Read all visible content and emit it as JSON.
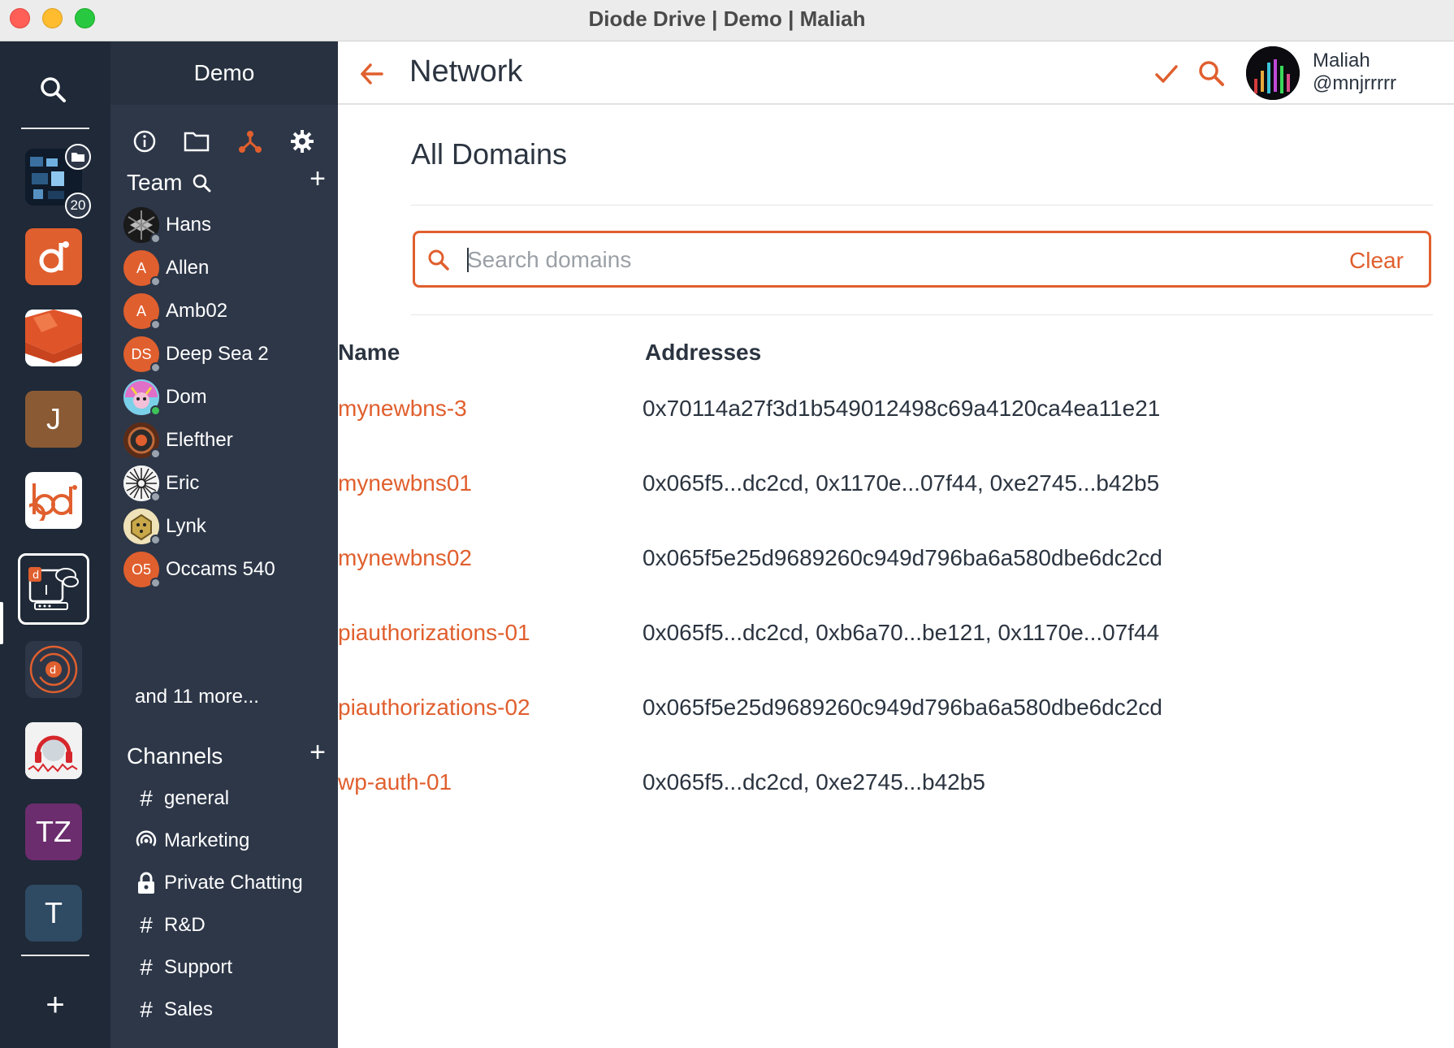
{
  "window": {
    "title": "Diode Drive | Demo | Maliah"
  },
  "rail": {
    "badge_count": "20",
    "tiles": [
      {
        "name": "tile-team-1",
        "letter": "",
        "color": "#1c2a3a"
      },
      {
        "name": "tile-diode",
        "letter": "",
        "color": "#e05f2e"
      },
      {
        "name": "tile-mail",
        "letter": "",
        "color": "#ffffff"
      },
      {
        "name": "tile-j",
        "letter": "J",
        "color": "#8a5a34"
      },
      {
        "name": "tile-bd",
        "letter": "",
        "color": "#ffffff"
      },
      {
        "name": "tile-demo",
        "letter": "",
        "color": "#1f2937"
      },
      {
        "name": "tile-orbit",
        "letter": "",
        "color": "#2d3748"
      },
      {
        "name": "tile-podcast",
        "letter": "",
        "color": "#ffffff"
      },
      {
        "name": "tile-tz",
        "letter": "TZ",
        "color": "#6b2d6e"
      },
      {
        "name": "tile-t",
        "letter": "T",
        "color": "#2f4a63"
      }
    ],
    "add_label": "+"
  },
  "sidebar": {
    "title": "Demo",
    "team_label": "Team",
    "add_label": "+",
    "members": [
      {
        "name": "Hans",
        "initials": "",
        "color": "#111111",
        "online": false
      },
      {
        "name": "Allen",
        "initials": "A",
        "color": "#e05f2e",
        "online": false
      },
      {
        "name": "Amb02",
        "initials": "A",
        "color": "#e05f2e",
        "online": false
      },
      {
        "name": "Deep Sea 2",
        "initials": "DS",
        "color": "#e05f2e",
        "online": false
      },
      {
        "name": "Dom",
        "initials": "",
        "color": "#c77dd6",
        "online": true
      },
      {
        "name": "Elefther",
        "initials": "",
        "color": "#7a3b22",
        "online": false
      },
      {
        "name": "Eric",
        "initials": "",
        "color": "#f4f4f4",
        "online": false
      },
      {
        "name": "Lynk",
        "initials": "",
        "color": "#d8c38a",
        "online": false
      },
      {
        "name": "Occams 540",
        "initials": "O5",
        "color": "#e05f2e",
        "online": false
      }
    ],
    "more_label": "and 11 more...",
    "channels_label": "Channels",
    "channels": [
      {
        "icon": "hash-icon",
        "glyph": "#",
        "name": "general"
      },
      {
        "icon": "broadcast-icon",
        "glyph": "",
        "name": "Marketing"
      },
      {
        "icon": "lock-icon",
        "glyph": "",
        "name": "Private Chatting"
      },
      {
        "icon": "hash-icon",
        "glyph": "#",
        "name": "R&D"
      },
      {
        "icon": "hash-icon",
        "glyph": "#",
        "name": "Support"
      },
      {
        "icon": "hash-icon",
        "glyph": "#",
        "name": "Sales"
      }
    ]
  },
  "header": {
    "title": "Network",
    "user_name": "Maliah",
    "user_handle": "@mnjrrrrr"
  },
  "content": {
    "section_title": "All Domains",
    "search": {
      "placeholder": "Search domains",
      "value": "",
      "clear_label": "Clear"
    },
    "columns": [
      "Name",
      "Addresses"
    ],
    "rows": [
      {
        "name": "mynewbns-3",
        "addresses": "0x70114a27f3d1b549012498c69a4120ca4ea11e21"
      },
      {
        "name": "mynewbns01",
        "addresses": "0x065f5...dc2cd, 0x1170e...07f44, 0xe2745...b42b5"
      },
      {
        "name": "mynewbns02",
        "addresses": "0x065f5e25d9689260c949d796ba6a580dbe6dc2cd"
      },
      {
        "name": "piauthorizations-01",
        "addresses": "0x065f5...dc2cd, 0xb6a70...be121, 0x1170e...07f44"
      },
      {
        "name": "piauthorizations-02",
        "addresses": "0x065f5e25d9689260c949d796ba6a580dbe6dc2cd"
      },
      {
        "name": "wp-auth-01",
        "addresses": "0x065f5...dc2cd, 0xe2745...b42b5"
      }
    ]
  },
  "colors": {
    "accent": "#e05f2e",
    "sidebar_bg": "#2d3748",
    "rail_bg": "#1f2937"
  }
}
